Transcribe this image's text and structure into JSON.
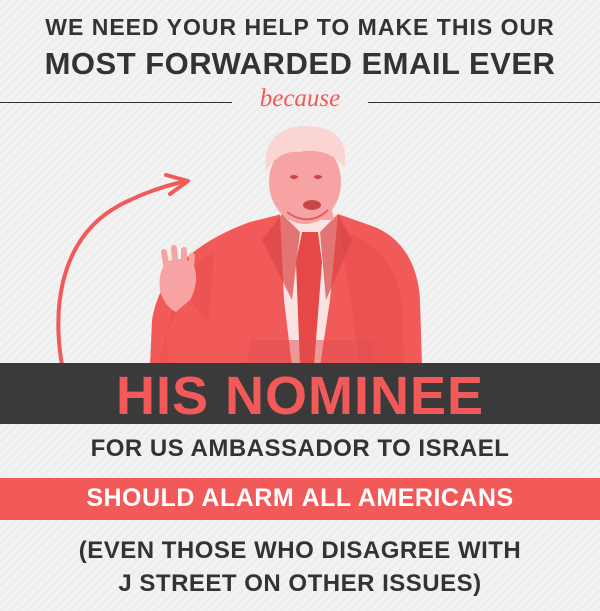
{
  "headline": {
    "line1": "WE NEED YOUR HELP TO MAKE THIS OUR",
    "line2": "MOST FORWARDED EMAIL EVER"
  },
  "divider_text": "because",
  "banner": {
    "nominee": "HIS NOMINEE",
    "ambassador": "FOR US AMBASSADOR TO ISRAEL",
    "alarm_prefix": "SHOULD ALARM ",
    "alarm_emphasis": "ALL AMERICANS",
    "paren_line1": "(EVEN THOSE WHO DISAGREE WITH",
    "paren_line2": "J STREET ON OTHER ISSUES)"
  },
  "colors": {
    "accent_red": "#f25a5a",
    "dark_gray": "#3a3a3a",
    "text_dark": "#333333",
    "background": "#f2f2f2"
  }
}
